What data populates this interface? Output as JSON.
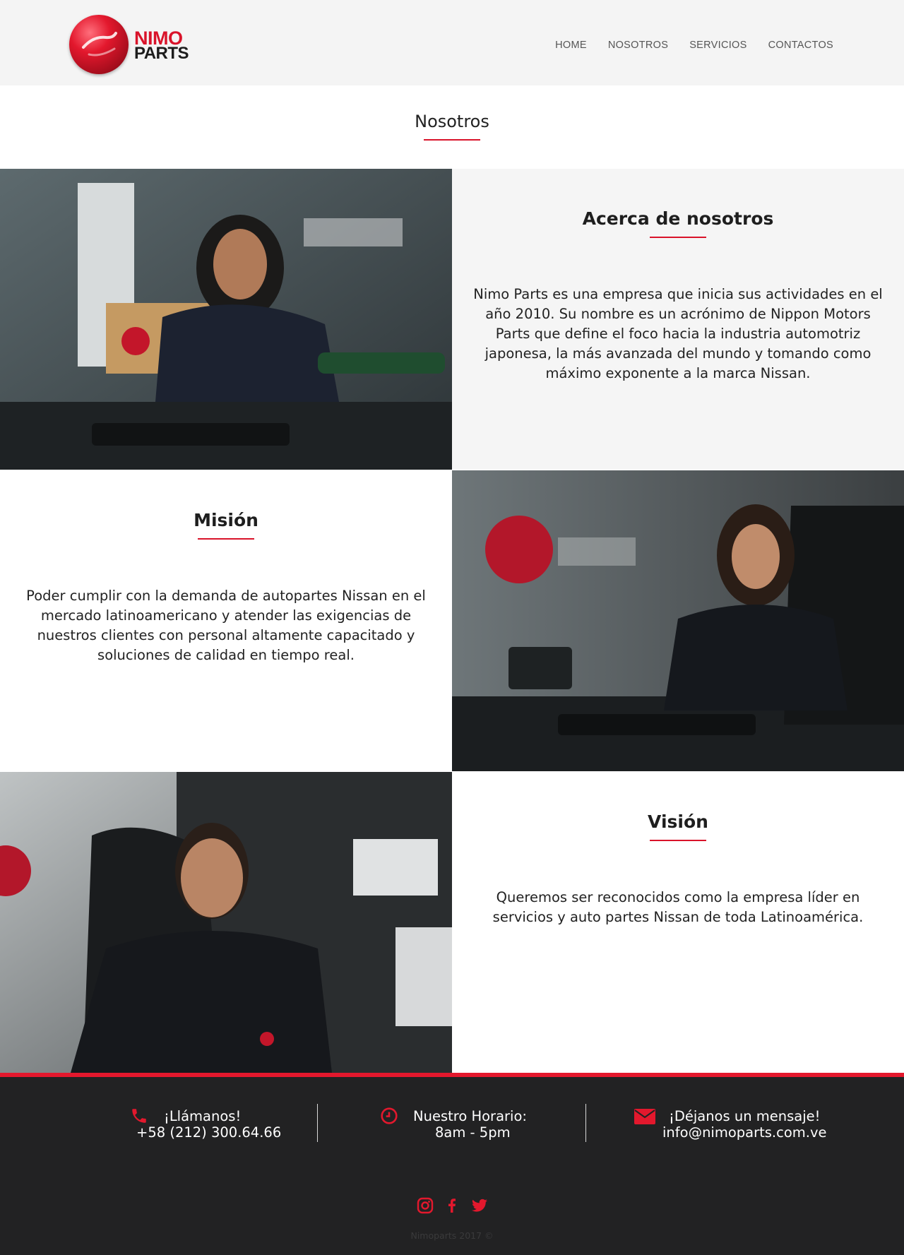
{
  "brand": {
    "name_line1": "NIMO",
    "name_line2": "PARTS",
    "accent_color": "#d9132a"
  },
  "nav": {
    "items": [
      {
        "label": "HOME"
      },
      {
        "label": "NOSOTROS"
      },
      {
        "label": "SERVICIOS"
      },
      {
        "label": "CONTACTOS"
      }
    ]
  },
  "page": {
    "title": "Nosotros"
  },
  "sections": {
    "about": {
      "heading": "Acerca de nosotros",
      "body": "Nimo Parts es una empresa que inicia sus actividades en el año 2010. Su nombre es un acrónimo de Nippon Motors Parts que define el foco hacia la industria automotriz japonesa, la más avanzada del mundo y tomando como máximo exponente a la marca Nissan."
    },
    "mission": {
      "heading": "Misión",
      "body": "Poder cumplir con la demanda de autopartes Nissan en el mercado latinoamericano y atender las exigencias de nuestros clientes con personal altamente capacitado y soluciones de calidad en tiempo real."
    },
    "vision": {
      "heading": "Visión",
      "body": "Queremos ser reconocidos como la empresa líder en servicios y auto partes Nissan de toda Latinoamérica."
    }
  },
  "footer": {
    "call": {
      "label": "¡Llámanos!",
      "value": "+58 (212) 300.64.66",
      "icon": "phone-icon"
    },
    "hours": {
      "label": "Nuestro Horario:",
      "value": "8am - 5pm",
      "icon": "clock-icon"
    },
    "message": {
      "label": "¡Déjanos un mensaje!",
      "value": "info@nimoparts.com.ve",
      "icon": "envelope-icon"
    },
    "social": [
      "instagram-icon",
      "facebook-icon",
      "twitter-icon"
    ],
    "copyright": "Nimoparts 2017 ©"
  }
}
